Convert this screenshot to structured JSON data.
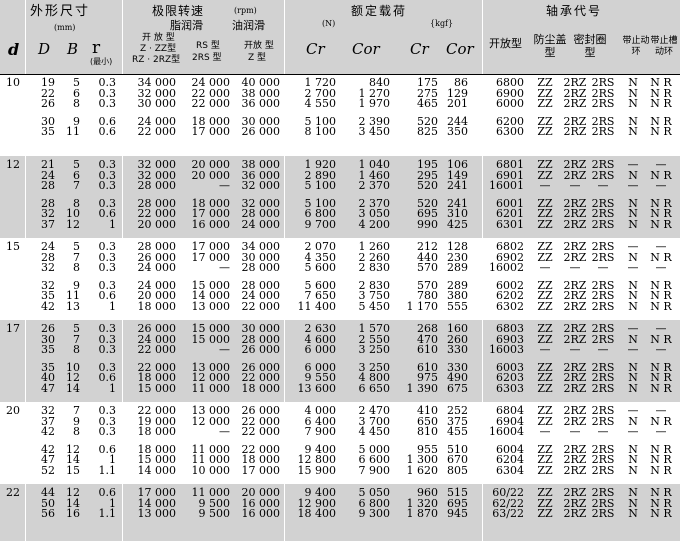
{
  "header": {
    "group_dims": "外形尺寸",
    "unit_mm": "(mm)",
    "group_speed": "极限转速",
    "unit_rpm": "(rpm)",
    "speed_grease": "脂润滑",
    "speed_oil": "油润滑",
    "speed_open": "开 放 型",
    "speed_z_2z": "Z · ZZ型",
    "speed_rz_2rz": "RZ · 2RZ型",
    "speed_rs": "RS 型",
    "speed_2rs": "2RS 型",
    "speed_open_oil": "开放 型",
    "speed_z": "Z 型",
    "group_load": "额定载荷",
    "unit_n": "(N)",
    "unit_kgf": "{kgf}",
    "group_code": "轴承代号",
    "code_open": "开放型",
    "code_shield": "防尘盖型",
    "code_seal": "密封圈型",
    "code_snap_stop": "带止动环",
    "code_snap_groove": "带止槽动环",
    "sym_d": "d",
    "sym_D": "D",
    "sym_B": "B",
    "sym_r": "r",
    "sym_r_min": "(最小)",
    "sym_cr": "Cr",
    "sym_cor": "Cor",
    "sym_cr2": "Cr",
    "sym_cor2": "Cor"
  },
  "groups": [
    {
      "d": "10",
      "subgroups": [
        {
          "D": [
            "19",
            "22",
            "26"
          ],
          "B": [
            "5",
            "6",
            "8"
          ],
          "r": [
            "0.3",
            "0.3",
            "0.3"
          ],
          "grease": [
            "34 000",
            "32 000",
            "30 000"
          ],
          "rs": [
            "24 000",
            "22 000",
            "22 000"
          ],
          "oil": [
            "40 000",
            "38 000",
            "36 000"
          ],
          "cr": [
            "1 720",
            "2 700",
            "4 550"
          ],
          "cor": [
            "840",
            "1 270",
            "1 970"
          ],
          "crk": [
            "175",
            "275",
            "465"
          ],
          "cork": [
            "86",
            "129",
            "201"
          ],
          "code": [
            "6800",
            "6900",
            "6000"
          ],
          "shield": [
            "ZZ",
            "ZZ",
            "ZZ"
          ],
          "seal": [
            "2RZ",
            "2RZ",
            "2RZ"
          ],
          "seal2": [
            "2RS",
            "2RS",
            "2RS"
          ],
          "stop": [
            "N",
            "N",
            "N"
          ],
          "groove": [
            "N R",
            "N R",
            "N R"
          ]
        },
        {
          "D": [
            "30",
            "35"
          ],
          "B": [
            "9",
            "11"
          ],
          "r": [
            "0.6",
            "0.6"
          ],
          "grease": [
            "24 000",
            "22 000"
          ],
          "rs": [
            "18 000",
            "17 000"
          ],
          "oil": [
            "30 000",
            "26 000"
          ],
          "cr": [
            "5 100",
            "8 100"
          ],
          "cor": [
            "2 390",
            "3 450"
          ],
          "crk": [
            "520",
            "825"
          ],
          "cork": [
            "244",
            "350"
          ],
          "code": [
            "6200",
            "6300"
          ],
          "shield": [
            "ZZ",
            "ZZ"
          ],
          "seal": [
            "2RZ",
            "2RZ"
          ],
          "seal2": [
            "2RS",
            "2RS"
          ],
          "stop": [
            "N",
            "N"
          ],
          "groove": [
            "N R",
            "N R"
          ]
        }
      ]
    },
    {
      "d": "12",
      "subgroups": [
        {
          "D": [
            "21",
            "24",
            "28"
          ],
          "B": [
            "5",
            "6",
            "7"
          ],
          "r": [
            "0.3",
            "0.3",
            "0.3"
          ],
          "grease": [
            "32 000",
            "32 000",
            "28 000"
          ],
          "rs": [
            "20 000",
            "20 000",
            "—"
          ],
          "oil": [
            "38 000",
            "36 000",
            "32 000"
          ],
          "cr": [
            "1 920",
            "2 890",
            "5 100"
          ],
          "cor": [
            "1 040",
            "1 460",
            "2 370"
          ],
          "crk": [
            "195",
            "295",
            "520"
          ],
          "cork": [
            "106",
            "149",
            "241"
          ],
          "code": [
            "6801",
            "6901",
            "16001"
          ],
          "shield": [
            "ZZ",
            "ZZ",
            "—"
          ],
          "seal": [
            "2RZ",
            "2RZ",
            "—"
          ],
          "seal2": [
            "2RS",
            "2RS",
            "—"
          ],
          "stop": [
            "—",
            "N",
            "—"
          ],
          "groove": [
            "—",
            "N R",
            "—"
          ]
        },
        {
          "D": [
            "28",
            "32",
            "37"
          ],
          "B": [
            "8",
            "10",
            "12"
          ],
          "r": [
            "0.3",
            "0.6",
            "1"
          ],
          "grease": [
            "28 000",
            "22 000",
            "20 000"
          ],
          "rs": [
            "18 000",
            "17 000",
            "16 000"
          ],
          "oil": [
            "32 000",
            "28 000",
            "24 000"
          ],
          "cr": [
            "5 100",
            "6 800",
            "9 700"
          ],
          "cor": [
            "2 370",
            "3 050",
            "4 200"
          ],
          "crk": [
            "520",
            "695",
            "990"
          ],
          "cork": [
            "241",
            "310",
            "425"
          ],
          "code": [
            "6001",
            "6201",
            "6301"
          ],
          "shield": [
            "ZZ",
            "ZZ",
            "ZZ"
          ],
          "seal": [
            "2RZ",
            "2RZ",
            "2RZ"
          ],
          "seal2": [
            "2RS",
            "2RS",
            "2RS"
          ],
          "stop": [
            "N",
            "N",
            "N"
          ],
          "groove": [
            "N R",
            "N R",
            "N R"
          ]
        }
      ]
    },
    {
      "d": "15",
      "subgroups": [
        {
          "D": [
            "24",
            "28",
            "32"
          ],
          "B": [
            "5",
            "7",
            "8"
          ],
          "r": [
            "0.3",
            "0.3",
            "0.3"
          ],
          "grease": [
            "28 000",
            "26 000",
            "24 000"
          ],
          "rs": [
            "17 000",
            "17 000",
            "—"
          ],
          "oil": [
            "34 000",
            "30 000",
            "28 000"
          ],
          "cr": [
            "2 070",
            "4 350",
            "5 600"
          ],
          "cor": [
            "1 260",
            "2 260",
            "2 830"
          ],
          "crk": [
            "212",
            "440",
            "570"
          ],
          "cork": [
            "128",
            "230",
            "289"
          ],
          "code": [
            "6802",
            "6902",
            "16002"
          ],
          "shield": [
            "ZZ",
            "ZZ",
            "—"
          ],
          "seal": [
            "2RZ",
            "2RZ",
            "—"
          ],
          "seal2": [
            "2RS",
            "2RS",
            "—"
          ],
          "stop": [
            "—",
            "N",
            "—"
          ],
          "groove": [
            "—",
            "N R",
            "—"
          ]
        },
        {
          "D": [
            "32",
            "35",
            "42"
          ],
          "B": [
            "9",
            "11",
            "13"
          ],
          "r": [
            "0.3",
            "0.6",
            "1"
          ],
          "grease": [
            "24 000",
            "20 000",
            "18 000"
          ],
          "rs": [
            "15 000",
            "14 000",
            "13 000"
          ],
          "oil": [
            "28 000",
            "24 000",
            "22 000"
          ],
          "cr": [
            "5 600",
            "7 650",
            "11 400"
          ],
          "cor": [
            "2 830",
            "3 750",
            "5 450"
          ],
          "crk": [
            "570",
            "780",
            "1 170"
          ],
          "cork": [
            "289",
            "380",
            "555"
          ],
          "code": [
            "6002",
            "6202",
            "6302"
          ],
          "shield": [
            "ZZ",
            "ZZ",
            "ZZ"
          ],
          "seal": [
            "2RZ",
            "2RZ",
            "2RZ"
          ],
          "seal2": [
            "2RS",
            "2RS",
            "2RS"
          ],
          "stop": [
            "N",
            "N",
            "N"
          ],
          "groove": [
            "N R",
            "N R",
            "N R"
          ]
        }
      ]
    },
    {
      "d": "17",
      "subgroups": [
        {
          "D": [
            "26",
            "30",
            "35"
          ],
          "B": [
            "5",
            "7",
            "8"
          ],
          "r": [
            "0.3",
            "0.3",
            "0.3"
          ],
          "grease": [
            "26 000",
            "24 000",
            "22 000"
          ],
          "rs": [
            "15 000",
            "15 000",
            "—"
          ],
          "oil": [
            "30 000",
            "28 000",
            "26 000"
          ],
          "cr": [
            "2 630",
            "4 600",
            "6 000"
          ],
          "cor": [
            "1 570",
            "2 550",
            "3 250"
          ],
          "crk": [
            "268",
            "470",
            "610"
          ],
          "cork": [
            "160",
            "260",
            "330"
          ],
          "code": [
            "6803",
            "6903",
            "16003"
          ],
          "shield": [
            "ZZ",
            "ZZ",
            "—"
          ],
          "seal": [
            "2RZ",
            "2RZ",
            "—"
          ],
          "seal2": [
            "2RS",
            "2RS",
            "—"
          ],
          "stop": [
            "—",
            "N",
            "—"
          ],
          "groove": [
            "—",
            "N R",
            "—"
          ]
        },
        {
          "D": [
            "35",
            "40",
            "47"
          ],
          "B": [
            "10",
            "12",
            "14"
          ],
          "r": [
            "0.3",
            "0.6",
            "1"
          ],
          "grease": [
            "22 000",
            "18 000",
            "15 000"
          ],
          "rs": [
            "13 000",
            "12 000",
            "11 000"
          ],
          "oil": [
            "26 000",
            "22 000",
            "18 000"
          ],
          "cr": [
            "6 000",
            "9 550",
            "13 600"
          ],
          "cor": [
            "3 250",
            "4 800",
            "6 650"
          ],
          "crk": [
            "610",
            "975",
            "1 390"
          ],
          "cork": [
            "330",
            "490",
            "675"
          ],
          "code": [
            "6003",
            "6203",
            "6303"
          ],
          "shield": [
            "ZZ",
            "ZZ",
            "ZZ"
          ],
          "seal": [
            "2RZ",
            "2RZ",
            "2RZ"
          ],
          "seal2": [
            "2RS",
            "2RS",
            "2RS"
          ],
          "stop": [
            "N",
            "N",
            "N"
          ],
          "groove": [
            "N R",
            "N R",
            "N R"
          ]
        }
      ]
    },
    {
      "d": "20",
      "subgroups": [
        {
          "D": [
            "32",
            "37",
            "42"
          ],
          "B": [
            "7",
            "9",
            "8"
          ],
          "r": [
            "0.3",
            "0.3",
            "0.3"
          ],
          "grease": [
            "22 000",
            "19 000",
            "18 000"
          ],
          "rs": [
            "13 000",
            "12 000",
            "—"
          ],
          "oil": [
            "26 000",
            "22 000",
            "22 000"
          ],
          "cr": [
            "4 000",
            "6 400",
            "7 900"
          ],
          "cor": [
            "2 470",
            "3 700",
            "4 450"
          ],
          "crk": [
            "410",
            "650",
            "810"
          ],
          "cork": [
            "252",
            "375",
            "455"
          ],
          "code": [
            "6804",
            "6904",
            "16004"
          ],
          "shield": [
            "ZZ",
            "ZZ",
            "—"
          ],
          "seal": [
            "2RZ",
            "2RZ",
            "—"
          ],
          "seal2": [
            "2RS",
            "2RS",
            "—"
          ],
          "stop": [
            "—",
            "N",
            "—"
          ],
          "groove": [
            "—",
            "N R",
            "—"
          ]
        },
        {
          "D": [
            "42",
            "47",
            "52"
          ],
          "B": [
            "12",
            "14",
            "15"
          ],
          "r": [
            "0.6",
            "1",
            "1.1"
          ],
          "grease": [
            "18 000",
            "15 000",
            "14 000"
          ],
          "rs": [
            "11 000",
            "11 000",
            "10 000"
          ],
          "oil": [
            "22 000",
            "18 000",
            "17 000"
          ],
          "cr": [
            "9 400",
            "12 800",
            "15 900"
          ],
          "cor": [
            "5 000",
            "6 600",
            "7 900"
          ],
          "crk": [
            "955",
            "1 300",
            "1 620"
          ],
          "cork": [
            "510",
            "670",
            "805"
          ],
          "code": [
            "6004",
            "6204",
            "6304"
          ],
          "shield": [
            "ZZ",
            "ZZ",
            "ZZ"
          ],
          "seal": [
            "2RZ",
            "2RZ",
            "2RZ"
          ],
          "seal2": [
            "2RS",
            "2RS",
            "2RS"
          ],
          "stop": [
            "N",
            "N",
            "N"
          ],
          "groove": [
            "N R",
            "N R",
            "N R"
          ]
        }
      ]
    },
    {
      "d": "22",
      "subgroups": [
        {
          "D": [
            "44",
            "50",
            "56"
          ],
          "B": [
            "12",
            "14",
            "16"
          ],
          "r": [
            "0.6",
            "1",
            "1.1"
          ],
          "grease": [
            "17 000",
            "14 000",
            "13 000"
          ],
          "rs": [
            "11 000",
            "9 500",
            "9 500"
          ],
          "oil": [
            "20 000",
            "16 000",
            "16 000"
          ],
          "cr": [
            "9 400",
            "12 900",
            "18 400"
          ],
          "cor": [
            "5 050",
            "6 800",
            "9 300"
          ],
          "crk": [
            "960",
            "1 320",
            "1 870"
          ],
          "cork": [
            "515",
            "695",
            "945"
          ],
          "code": [
            "60/22",
            "62/22",
            "63/22"
          ],
          "shield": [
            "ZZ",
            "ZZ",
            "ZZ"
          ],
          "seal": [
            "2RZ",
            "2RZ",
            "2RZ"
          ],
          "seal2": [
            "2RS",
            "2RS",
            "2RS"
          ],
          "stop": [
            "N",
            "N",
            "N"
          ],
          "groove": [
            "N R",
            "N R",
            "N R"
          ]
        }
      ]
    }
  ]
}
